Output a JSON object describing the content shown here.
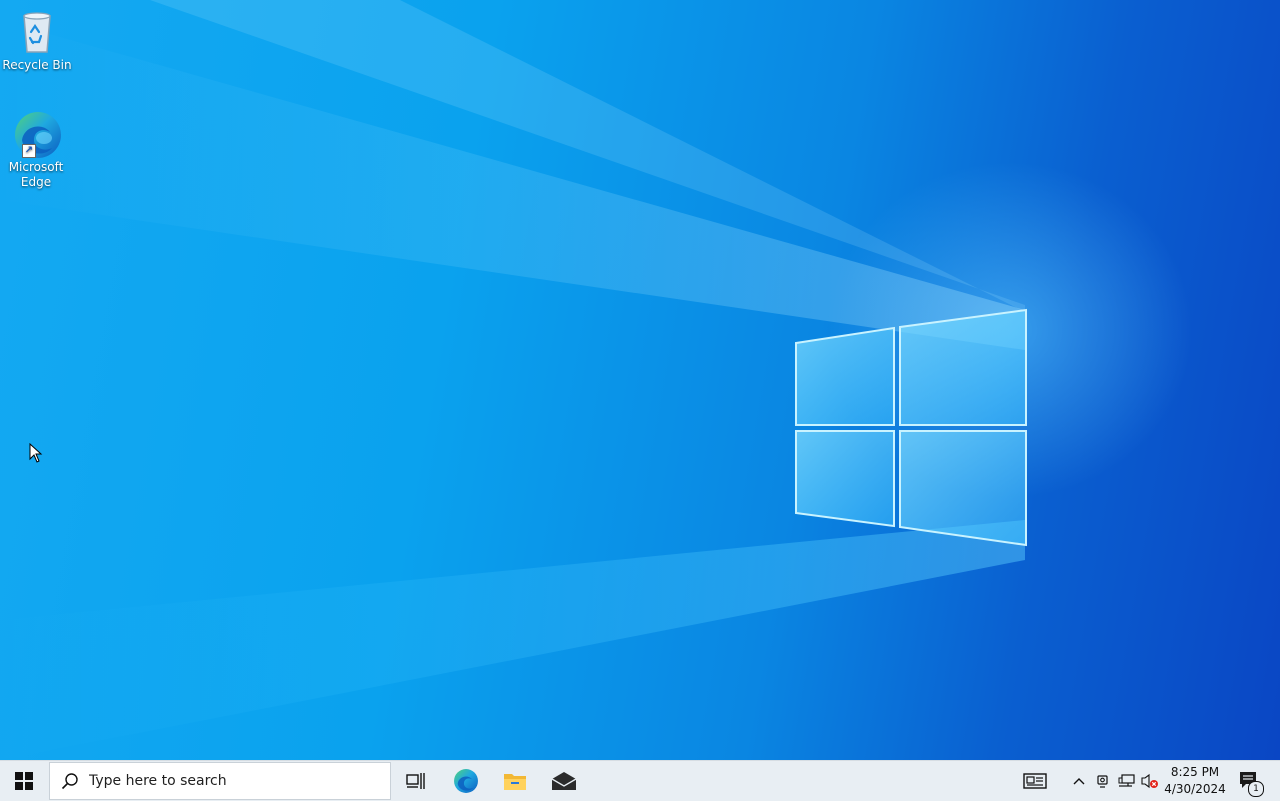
{
  "desktop": {
    "icons": [
      {
        "label": "Recycle Bin",
        "icon": "recycle-bin-icon"
      },
      {
        "label": "Microsoft Edge",
        "icon": "edge-icon"
      }
    ]
  },
  "taskbar": {
    "start_icon": "windows-logo-icon",
    "search_placeholder": "Type here to search",
    "pinned": [
      "task-view-icon",
      "edge-icon",
      "file-explorer-icon",
      "mail-icon"
    ],
    "tray_icons": [
      "news-widget-icon",
      "chevron-up-icon",
      "meet-now-icon",
      "network-icon",
      "volume-muted-icon"
    ],
    "time": "8:25 PM",
    "date": "4/30/2024",
    "notification_count": "1"
  },
  "colors": {
    "taskbar_bg": "#e8eef3",
    "accent": "#0a86e2"
  }
}
